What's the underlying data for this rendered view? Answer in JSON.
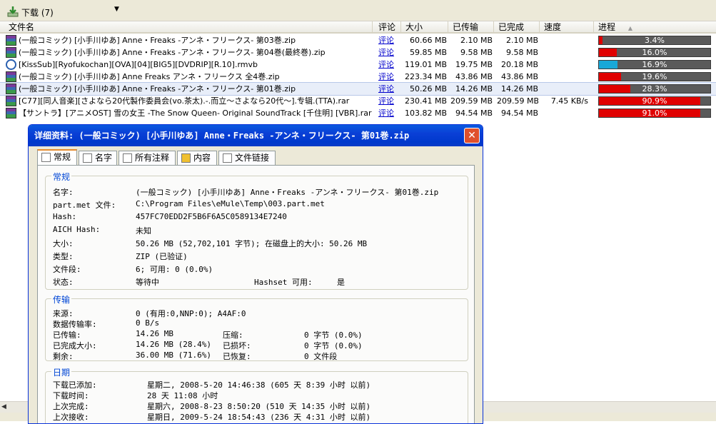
{
  "toolbar": {
    "title": "下载 (7)",
    "dropdown_icon": "chevron-down-icon"
  },
  "columns": {
    "name": "文件名",
    "comment": "评论",
    "size": "大小",
    "transferred": "已传输",
    "completed": "已完成",
    "speed": "速度",
    "progress": "进程"
  },
  "files": [
    {
      "icon": "rar",
      "name": "(一般コミック) [小手川ゆあ] Anne・Freaks -アンネ・フリークス- 第03巻.zip",
      "comment": "评论",
      "size": "60.66 MB",
      "transferred": "2.10 MB",
      "completed": "2.10 MB",
      "speed": "",
      "progress_text": "3.4%",
      "progress": 0.034
    },
    {
      "icon": "rar",
      "name": "(一般コミック) [小手川ゆあ] Anne・Freaks -アンネ・フリークス- 第04巻(最終巻).zip",
      "comment": "评论",
      "size": "59.85 MB",
      "transferred": "9.58 MB",
      "completed": "9.58 MB",
      "speed": "",
      "progress_text": "16.0%",
      "progress": 0.16
    },
    {
      "icon": "rmvb",
      "name": "[KissSub][Ryofukochan][OVA][04][BIG5][DVDRIP][R.10].rmvb",
      "comment": "评论",
      "size": "119.01 MB",
      "transferred": "19.75 MB",
      "completed": "20.18 MB",
      "speed": "",
      "progress_text": "16.9%",
      "progress": 0.169
    },
    {
      "icon": "rar",
      "name": "(一般コミック) [小手川ゆあ] Anne Freaks アンネ・フリークス 全4巻.zip",
      "comment": "评论",
      "size": "223.34 MB",
      "transferred": "43.86 MB",
      "completed": "43.86 MB",
      "speed": "",
      "progress_text": "19.6%",
      "progress": 0.196
    },
    {
      "icon": "rar",
      "name": "(一般コミック) [小手川ゆあ] Anne・Freaks -アンネ・フリークス- 第01巻.zip",
      "comment": "评论",
      "size": "50.26 MB",
      "transferred": "14.26 MB",
      "completed": "14.26 MB",
      "speed": "",
      "progress_text": "28.3%",
      "progress": 0.283
    },
    {
      "icon": "rar",
      "name": "[C77][同人音楽][さよなら20代製作委員会(vo.茶太).-.而立～さよなら20代～].专辑.(TTA).rar",
      "comment": "评论",
      "size": "230.41 MB",
      "transferred": "209.59 MB",
      "completed": "209.59 MB",
      "speed": "7.45 KB/s",
      "progress_text": "90.9%",
      "progress": 0.909
    },
    {
      "icon": "rar",
      "name": "【サントラ】[アニメOST] 雪の女王 -The Snow Queen- Original SoundTrack [千住明] [VBR].rar",
      "comment": "评论",
      "size": "103.82 MB",
      "transferred": "94.54 MB",
      "completed": "94.54 MB",
      "speed": "",
      "progress_text": "91.0%",
      "progress": 0.91
    }
  ],
  "dialog": {
    "title": "详细资料: (一般コミック) [小手川ゆあ] Anne・Freaks -アンネ・フリークス- 第01巻.zip",
    "close_label": "✕",
    "tabs": [
      "常规",
      "名字",
      "所有注释",
      "内容",
      "文件链接"
    ],
    "general": {
      "group_title": "常规",
      "name_label": "名字:",
      "name_value": "(一般コミック) [小手川ゆあ] Anne・Freaks -アンネ・フリークス- 第01巻.zip",
      "partmet_label": "part.met 文件:",
      "partmet_value": "C:\\Program Files\\eMule\\Temp\\003.part.met",
      "hash_label": "Hash:",
      "hash_value": "457FC70EDD2F5B6F6A5C0589134E7240",
      "aich_label": "AICH Hash:",
      "aich_value": "未知",
      "size_label": "大小:",
      "size_value": "50.26 MB  (52,702,101 字节);  在磁盘上的大小: 50.26 MB",
      "type_label": "类型:",
      "type_value": "ZIP  (已验证)",
      "parts_label": "文件段:",
      "parts_value": "6;  可用: 0 (0.0%)",
      "status_label": "状态:",
      "status_value": "等待中",
      "hashset_label": "Hashset 可用:",
      "hashset_value": "是"
    },
    "transfer": {
      "group_title": "传输",
      "sources_label": "来源:",
      "sources_value": "0 (有用:0,NNP:0); A4AF:0",
      "rate_label": "数据传输率:",
      "rate_value": "0 B/s",
      "transferred_label": "已传输:",
      "transferred_value": "14.26 MB",
      "completed_label": "已完成大小:",
      "completed_value": "14.26 MB (28.4%)",
      "remaining_label": "剩余:",
      "remaining_value": "36.00 MB (71.6%)",
      "compressed_label": "压缩:",
      "compressed_value": "0 字节 (0.0%)",
      "corrupted_label": "已损坏:",
      "corrupted_value": "0 字节 (0.0%)",
      "recovered_label": "已恢复:",
      "recovered_value": "0 文件段"
    },
    "dates": {
      "group_title": "日期",
      "added_label": "下载已添加:",
      "added_value": "星期二, 2008-5-20 14:46:38   (605 天 8:39 小时 以前)",
      "dltime_label": "下载时间:",
      "dltime_value": "28 天 11:08 小时",
      "lastcomplete_label": "上次完成:",
      "lastcomplete_value": "星期六, 2008-8-23 8:50:20   (510 天 14:35 小时 以前)",
      "lastrecv_label": "上次接收:",
      "lastrecv_value": "星期日, 2009-5-24 18:54:43   (236 天 4:31 小时 以前)"
    }
  },
  "colors": {
    "progress_fill": "#e00000",
    "progress_bg": "#5a5a5a",
    "title_bar": "#0a3fd6",
    "group_title": "#0046d5"
  }
}
